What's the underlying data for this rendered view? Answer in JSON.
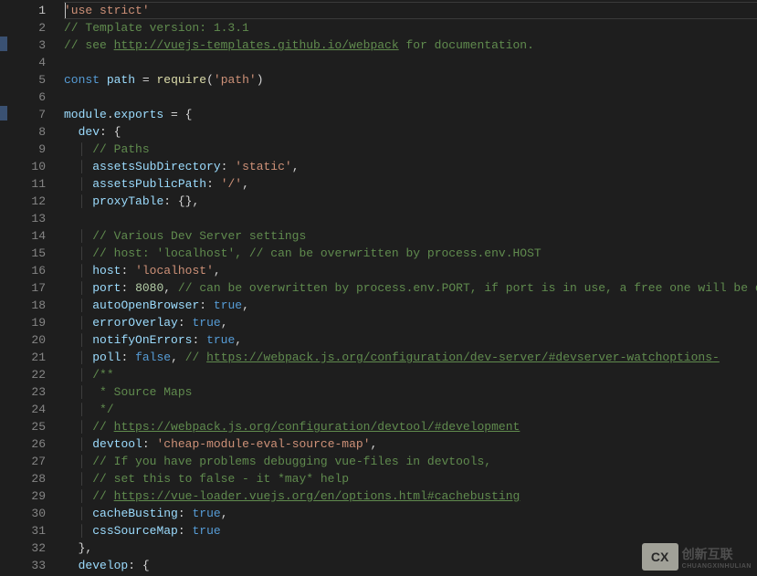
{
  "editor": {
    "language": "javascript",
    "currentLine": 1,
    "lineCount": 33,
    "markers": [
      3,
      7
    ],
    "lines": [
      {
        "n": 1,
        "ind": 0,
        "tokens": [
          {
            "c": "s-string",
            "t": "'use strict'"
          }
        ]
      },
      {
        "n": 2,
        "ind": 0,
        "tokens": [
          {
            "c": "s-comment",
            "t": "// Template version: 1.3.1"
          }
        ]
      },
      {
        "n": 3,
        "ind": 0,
        "tokens": [
          {
            "c": "s-comment",
            "t": "// see "
          },
          {
            "c": "s-link",
            "t": "http://vuejs-templates.github.io/webpack"
          },
          {
            "c": "s-comment",
            "t": " for documentation."
          }
        ]
      },
      {
        "n": 4,
        "ind": 0,
        "tokens": []
      },
      {
        "n": 5,
        "ind": 0,
        "tokens": [
          {
            "c": "s-keyword",
            "t": "const"
          },
          {
            "c": "",
            "t": " "
          },
          {
            "c": "s-var",
            "t": "path"
          },
          {
            "c": "",
            "t": " "
          },
          {
            "c": "s-punc",
            "t": "="
          },
          {
            "c": "",
            "t": " "
          },
          {
            "c": "s-func",
            "t": "require"
          },
          {
            "c": "s-punc",
            "t": "("
          },
          {
            "c": "s-string",
            "t": "'path'"
          },
          {
            "c": "s-punc",
            "t": ")"
          }
        ]
      },
      {
        "n": 6,
        "ind": 0,
        "tokens": []
      },
      {
        "n": 7,
        "ind": 0,
        "tokens": [
          {
            "c": "s-var",
            "t": "module"
          },
          {
            "c": "s-punc",
            "t": "."
          },
          {
            "c": "s-var",
            "t": "exports"
          },
          {
            "c": "",
            "t": " "
          },
          {
            "c": "s-punc",
            "t": "="
          },
          {
            "c": "",
            "t": " "
          },
          {
            "c": "s-punc",
            "t": "{"
          }
        ]
      },
      {
        "n": 8,
        "ind": 1,
        "tokens": [
          {
            "c": "s-prop",
            "t": "dev"
          },
          {
            "c": "s-punc",
            "t": ":"
          },
          {
            "c": "",
            "t": " "
          },
          {
            "c": "s-punc",
            "t": "{"
          }
        ]
      },
      {
        "n": 9,
        "ind": 2,
        "tokens": [
          {
            "c": "s-comment",
            "t": "// Paths"
          }
        ]
      },
      {
        "n": 10,
        "ind": 2,
        "tokens": [
          {
            "c": "s-prop",
            "t": "assetsSubDirectory"
          },
          {
            "c": "s-punc",
            "t": ":"
          },
          {
            "c": "",
            "t": " "
          },
          {
            "c": "s-string",
            "t": "'static'"
          },
          {
            "c": "s-punc",
            "t": ","
          }
        ]
      },
      {
        "n": 11,
        "ind": 2,
        "tokens": [
          {
            "c": "s-prop",
            "t": "assetsPublicPath"
          },
          {
            "c": "s-punc",
            "t": ":"
          },
          {
            "c": "",
            "t": " "
          },
          {
            "c": "s-string",
            "t": "'/'"
          },
          {
            "c": "s-punc",
            "t": ","
          }
        ]
      },
      {
        "n": 12,
        "ind": 2,
        "tokens": [
          {
            "c": "s-prop",
            "t": "proxyTable"
          },
          {
            "c": "s-punc",
            "t": ":"
          },
          {
            "c": "",
            "t": " "
          },
          {
            "c": "s-punc",
            "t": "{},"
          }
        ]
      },
      {
        "n": 13,
        "ind": 0,
        "tokens": []
      },
      {
        "n": 14,
        "ind": 2,
        "tokens": [
          {
            "c": "s-comment",
            "t": "// Various Dev Server settings"
          }
        ]
      },
      {
        "n": 15,
        "ind": 2,
        "tokens": [
          {
            "c": "s-comment",
            "t": "// host: 'localhost', // can be overwritten by process.env.HOST"
          }
        ]
      },
      {
        "n": 16,
        "ind": 2,
        "tokens": [
          {
            "c": "s-prop",
            "t": "host"
          },
          {
            "c": "s-punc",
            "t": ":"
          },
          {
            "c": "",
            "t": " "
          },
          {
            "c": "s-string",
            "t": "'localhost'"
          },
          {
            "c": "s-punc",
            "t": ","
          }
        ]
      },
      {
        "n": 17,
        "ind": 2,
        "tokens": [
          {
            "c": "s-prop",
            "t": "port"
          },
          {
            "c": "s-punc",
            "t": ":"
          },
          {
            "c": "",
            "t": " "
          },
          {
            "c": "s-num",
            "t": "8080"
          },
          {
            "c": "s-punc",
            "t": ","
          },
          {
            "c": "",
            "t": " "
          },
          {
            "c": "s-comment",
            "t": "// can be overwritten by process.env.PORT, if port is in use, a free one will be d"
          }
        ]
      },
      {
        "n": 18,
        "ind": 2,
        "tokens": [
          {
            "c": "s-prop",
            "t": "autoOpenBrowser"
          },
          {
            "c": "s-punc",
            "t": ":"
          },
          {
            "c": "",
            "t": " "
          },
          {
            "c": "s-bool",
            "t": "true"
          },
          {
            "c": "s-punc",
            "t": ","
          }
        ]
      },
      {
        "n": 19,
        "ind": 2,
        "tokens": [
          {
            "c": "s-prop",
            "t": "errorOverlay"
          },
          {
            "c": "s-punc",
            "t": ":"
          },
          {
            "c": "",
            "t": " "
          },
          {
            "c": "s-bool",
            "t": "true"
          },
          {
            "c": "s-punc",
            "t": ","
          }
        ]
      },
      {
        "n": 20,
        "ind": 2,
        "tokens": [
          {
            "c": "s-prop",
            "t": "notifyOnErrors"
          },
          {
            "c": "s-punc",
            "t": ":"
          },
          {
            "c": "",
            "t": " "
          },
          {
            "c": "s-bool",
            "t": "true"
          },
          {
            "c": "s-punc",
            "t": ","
          }
        ]
      },
      {
        "n": 21,
        "ind": 2,
        "tokens": [
          {
            "c": "s-prop",
            "t": "poll"
          },
          {
            "c": "s-punc",
            "t": ":"
          },
          {
            "c": "",
            "t": " "
          },
          {
            "c": "s-bool",
            "t": "false"
          },
          {
            "c": "s-punc",
            "t": ","
          },
          {
            "c": "",
            "t": " "
          },
          {
            "c": "s-comment",
            "t": "// "
          },
          {
            "c": "s-link",
            "t": "https://webpack.js.org/configuration/dev-server/#devserver-watchoptions-"
          }
        ]
      },
      {
        "n": 22,
        "ind": 2,
        "tokens": [
          {
            "c": "s-comment",
            "t": "/**"
          }
        ]
      },
      {
        "n": 23,
        "ind": 2,
        "tokens": [
          {
            "c": "s-comment",
            "t": " * Source Maps"
          }
        ]
      },
      {
        "n": 24,
        "ind": 2,
        "tokens": [
          {
            "c": "s-comment",
            "t": " */"
          }
        ]
      },
      {
        "n": 25,
        "ind": 2,
        "tokens": [
          {
            "c": "s-comment",
            "t": "// "
          },
          {
            "c": "s-link",
            "t": "https://webpack.js.org/configuration/devtool/#development"
          }
        ]
      },
      {
        "n": 26,
        "ind": 2,
        "tokens": [
          {
            "c": "s-prop",
            "t": "devtool"
          },
          {
            "c": "s-punc",
            "t": ":"
          },
          {
            "c": "",
            "t": " "
          },
          {
            "c": "s-string",
            "t": "'cheap-module-eval-source-map'"
          },
          {
            "c": "s-punc",
            "t": ","
          }
        ]
      },
      {
        "n": 27,
        "ind": 2,
        "tokens": [
          {
            "c": "s-comment",
            "t": "// If you have problems debugging vue-files in devtools,"
          }
        ]
      },
      {
        "n": 28,
        "ind": 2,
        "tokens": [
          {
            "c": "s-comment",
            "t": "// set this to false - it *may* help"
          }
        ]
      },
      {
        "n": 29,
        "ind": 2,
        "tokens": [
          {
            "c": "s-comment",
            "t": "// "
          },
          {
            "c": "s-link",
            "t": "https://vue-loader.vuejs.org/en/options.html#cachebusting"
          }
        ]
      },
      {
        "n": 30,
        "ind": 2,
        "tokens": [
          {
            "c": "s-prop",
            "t": "cacheBusting"
          },
          {
            "c": "s-punc",
            "t": ":"
          },
          {
            "c": "",
            "t": " "
          },
          {
            "c": "s-bool",
            "t": "true"
          },
          {
            "c": "s-punc",
            "t": ","
          }
        ]
      },
      {
        "n": 31,
        "ind": 2,
        "tokens": [
          {
            "c": "s-prop",
            "t": "cssSourceMap"
          },
          {
            "c": "s-punc",
            "t": ":"
          },
          {
            "c": "",
            "t": " "
          },
          {
            "c": "s-bool",
            "t": "true"
          }
        ]
      },
      {
        "n": 32,
        "ind": 1,
        "tokens": [
          {
            "c": "s-punc",
            "t": "},"
          }
        ]
      },
      {
        "n": 33,
        "ind": 1,
        "tokens": [
          {
            "c": "s-prop",
            "t": "develop"
          },
          {
            "c": "s-punc",
            "t": ":"
          },
          {
            "c": "",
            "t": " "
          },
          {
            "c": "s-punc",
            "t": "{"
          }
        ]
      }
    ]
  },
  "watermark": {
    "logo_letters": "CX",
    "text_top": "创新互联",
    "text_bottom": "CHUANGXINHULIAN"
  }
}
